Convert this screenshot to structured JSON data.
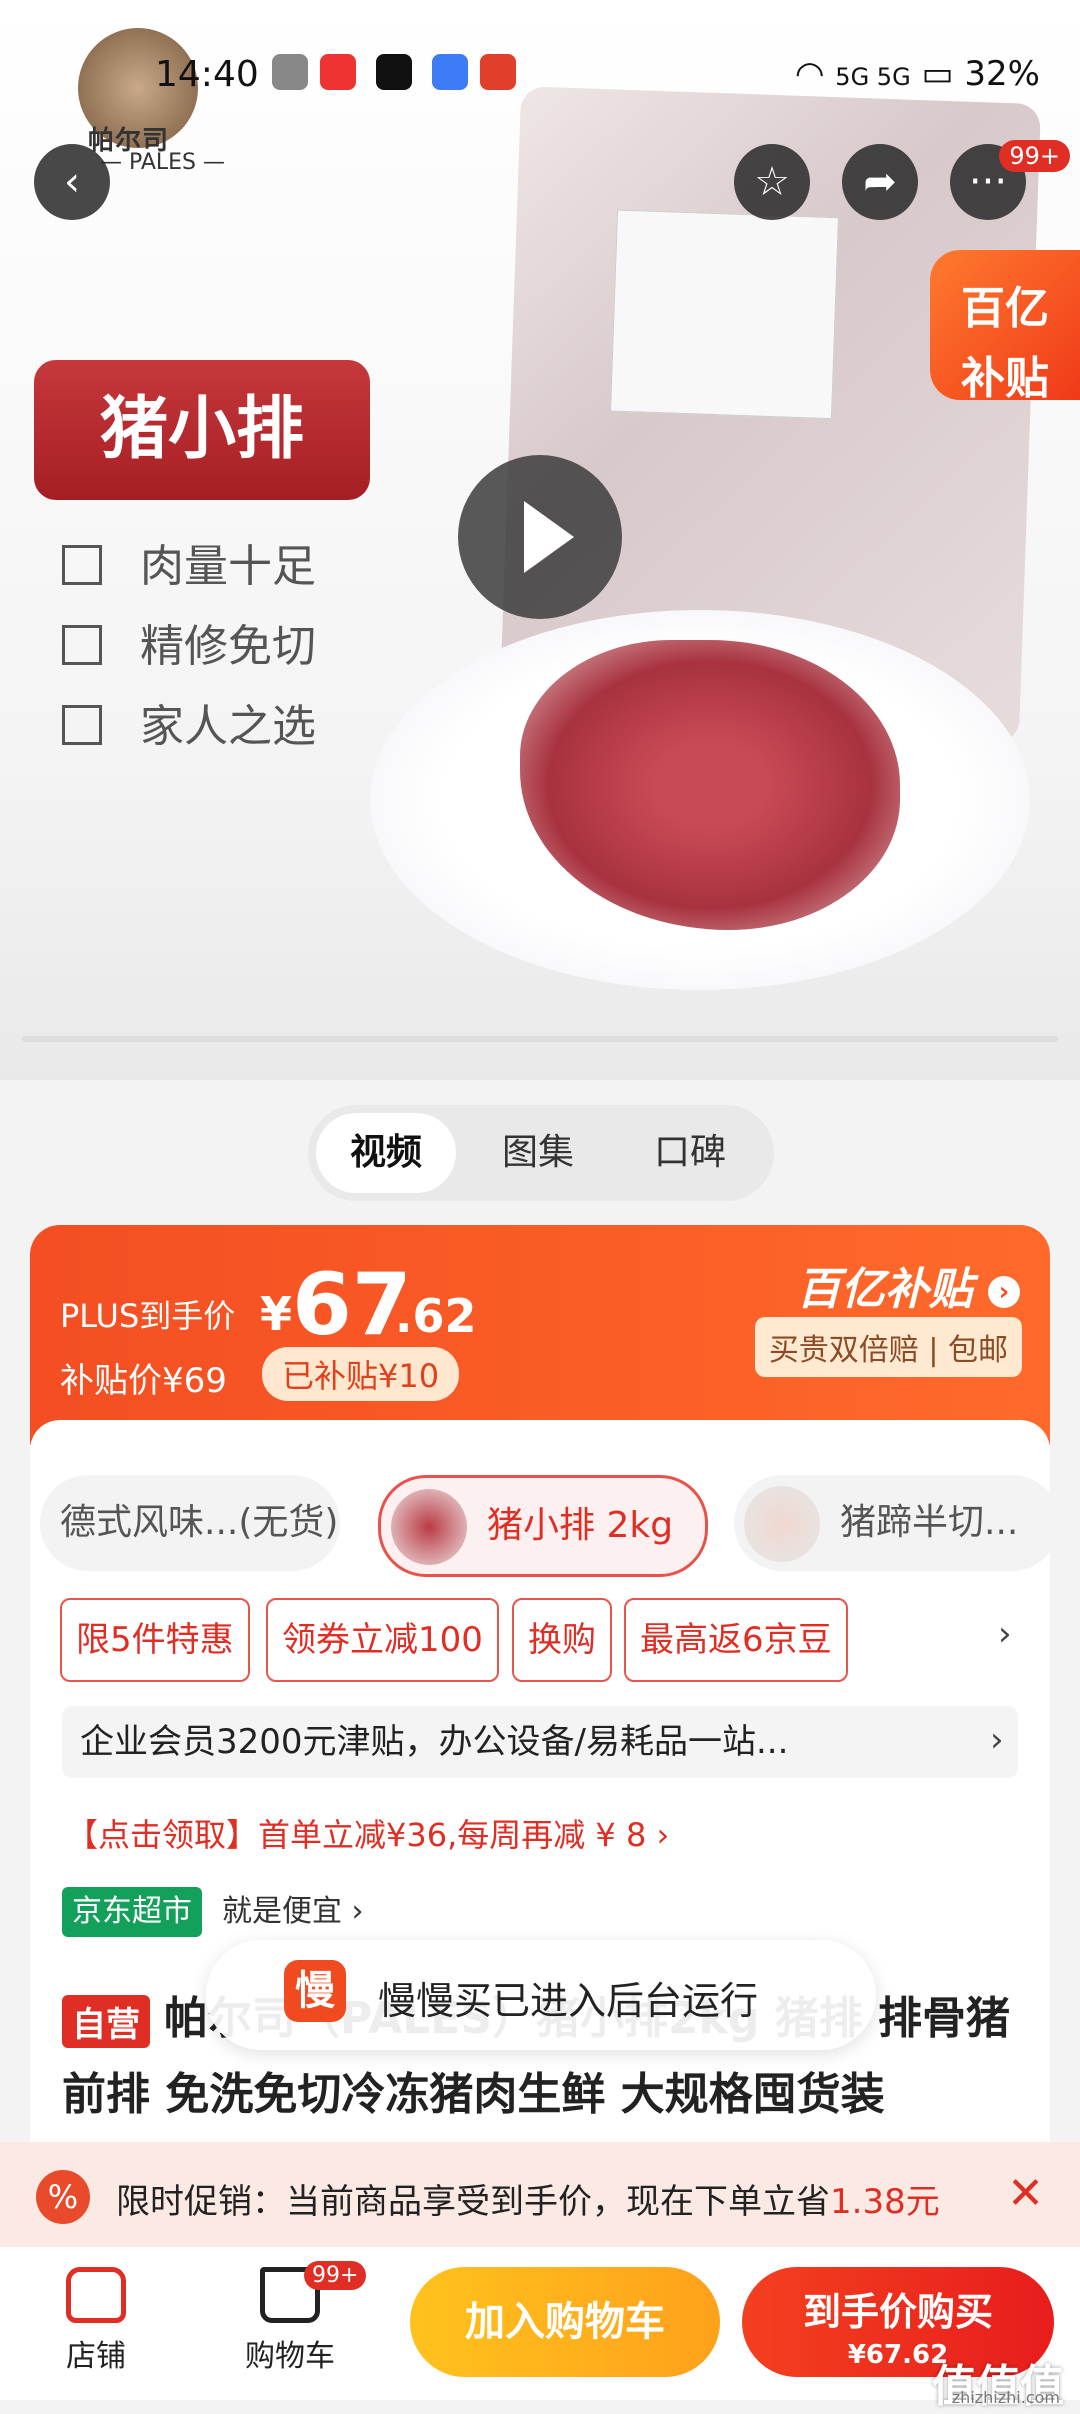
{
  "status_bar": {
    "time": "14:40",
    "battery": "32%",
    "network": "5G 5G"
  },
  "hero": {
    "brand_logo_text": "帕尔司",
    "brand_logo_sub": "— PALES —",
    "product_name": "猪小排",
    "features": [
      "肉量十足",
      "精修免切",
      "家人之选"
    ],
    "subsidy_tag_line1": "百亿",
    "subsidy_tag_line2": "补贴",
    "badge_count": "99+"
  },
  "media_tabs": [
    "视频",
    "图集",
    "口碑"
  ],
  "price": {
    "plus_label": "PLUS到手价",
    "currency": "¥",
    "integer": "67",
    "decimal": ".62",
    "subsidy_price_label": "补贴价¥69",
    "subsidized_chip": "已补贴¥10",
    "brand_label": "百亿补贴",
    "guarantee": "买贵双倍赔 | 包邮"
  },
  "variants": [
    {
      "label": "德式风味...(无货)",
      "active": false
    },
    {
      "label": "猪小排 2kg",
      "active": true
    },
    {
      "label": "猪蹄半切...",
      "active": false
    }
  ],
  "promos": [
    "限5件特惠",
    "领券立减100",
    "换购",
    "最高返6京豆"
  ],
  "enterprise_banner": "企业会员3200元津贴，办公设备/易耗品一站...",
  "coupon_line": "【点击领取】首单立减¥36,每周再减 ¥ 8 ›",
  "store": {
    "tag": "京东超市",
    "slogan": "就是便宜 ›"
  },
  "title": {
    "self_tag": "自营",
    "line1": "帕尔司（PALES）猪小排2kg 猪排 排骨猪",
    "line2": "前排 免洗免切冷冻猪肉生鲜 大规格囤货装"
  },
  "toast": {
    "icon": "慢",
    "text": "慢慢买已进入后台运行"
  },
  "limited_promo": {
    "prefix": "限时促销：当前商品享受到手价，现在下单立省",
    "amount": "1.38元"
  },
  "bottom_bar": {
    "store_label": "店铺",
    "cart_label": "购物车",
    "cart_badge": "99+",
    "add_to_cart": "加入购物车",
    "buy_label": "到手价购买",
    "buy_price": "¥67.62"
  },
  "watermark": "值值值",
  "watermark_sub": "zhizhizhi.com"
}
